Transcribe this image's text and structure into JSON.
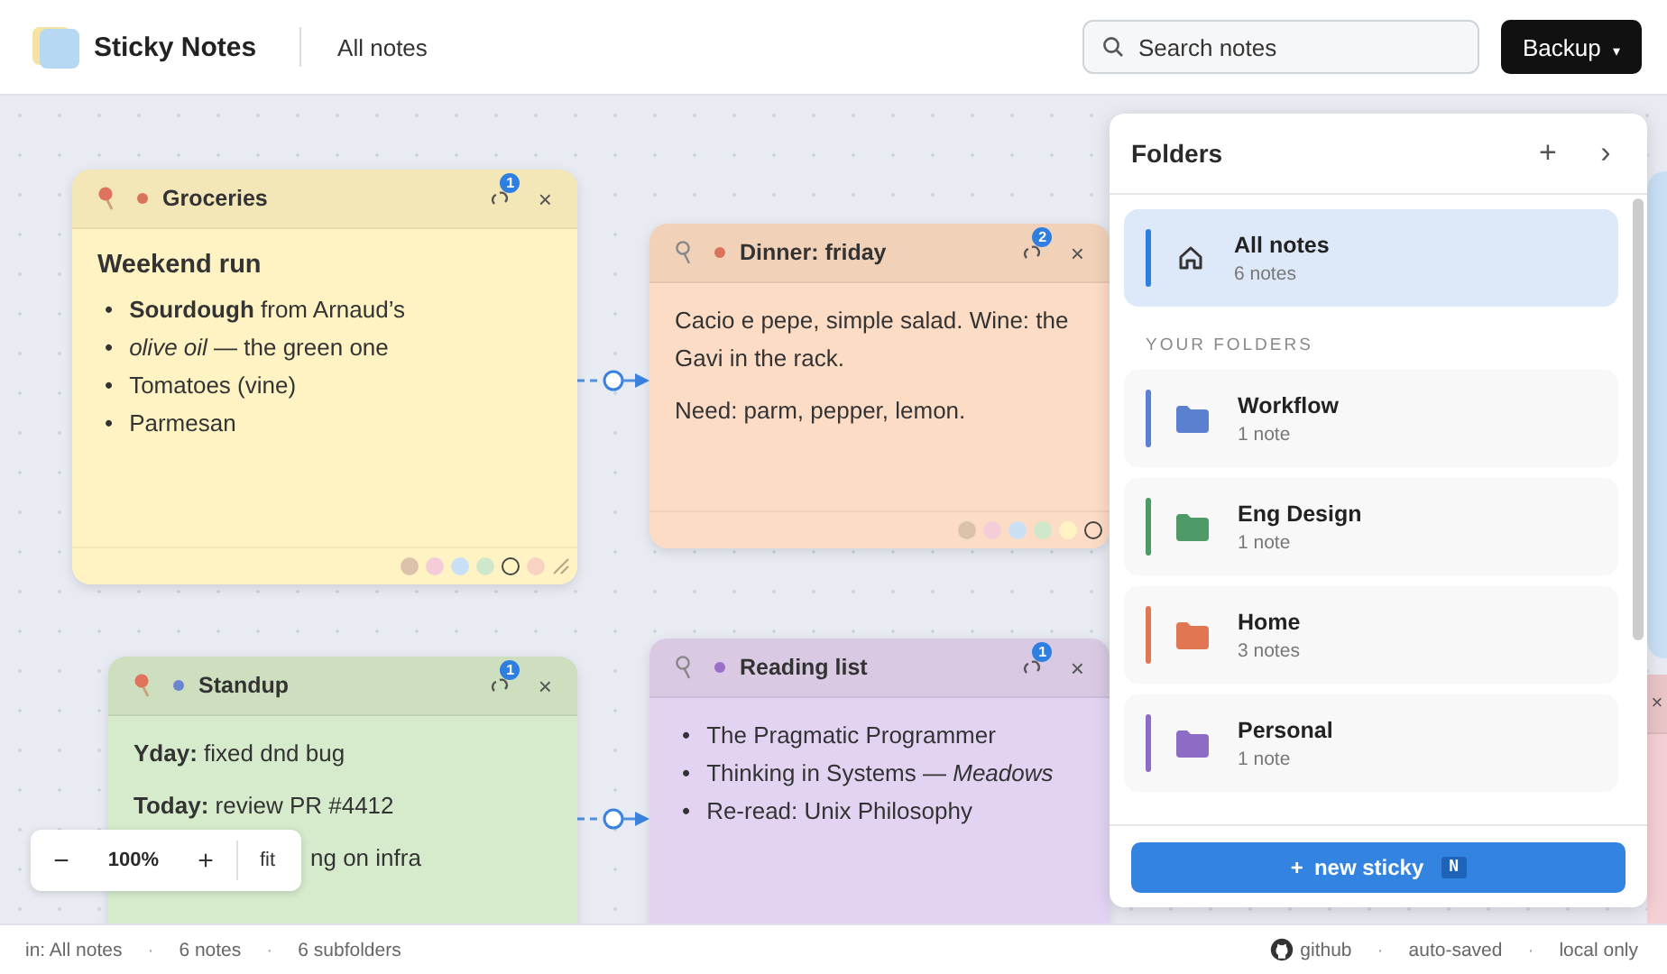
{
  "app": {
    "name": "Sticky Notes",
    "breadcrumb": "All notes"
  },
  "search": {
    "placeholder": "Search notes"
  },
  "backup_button": {
    "label": "Backup",
    "caret": "▾"
  },
  "notes": [
    {
      "title": "Groceries",
      "color": "#fff3c4",
      "pinned": true,
      "dot": {
        "color": "#d9735a"
      },
      "links": "1",
      "close": "×",
      "blocks": [
        {
          "kind": "heading",
          "text": "Weekend run"
        },
        {
          "kind": "list",
          "bullet": "•",
          "items": [
            "**Sourdough** from Arnaud’s",
            "*olive oil* — the green one",
            "Tomatoes (vine)",
            "Parmesan"
          ]
        }
      ],
      "swatches": [
        {
          "color": "#dcc2ab",
          "selected": false
        },
        {
          "color": "#f4cdd8",
          "selected": false
        },
        {
          "color": "#c9dff3",
          "selected": false
        },
        {
          "color": "#cfe8cb",
          "selected": false
        },
        {
          "color": "#fff3c4",
          "selected": true
        },
        {
          "color": "#f8d3c2",
          "selected": false
        }
      ]
    },
    {
      "title": "Dinner: friday",
      "color": "#fddcc6",
      "pinned": false,
      "dot": {
        "color": "#d9735a"
      },
      "links": "2",
      "close": "×",
      "blocks": [
        {
          "kind": "para",
          "text": "Cacio e pepe, simple salad. Wine: the Gavi in the rack."
        },
        {
          "kind": "para",
          "text": "Need: parm, pepper, lemon."
        }
      ],
      "swatches": [
        {
          "color": "#dcc2ab",
          "selected": false
        },
        {
          "color": "#f4cdd8",
          "selected": false
        },
        {
          "color": "#c9dff3",
          "selected": false
        },
        {
          "color": "#cfe8cb",
          "selected": false
        },
        {
          "color": "#fff3c4",
          "selected": false
        },
        {
          "color": "#fddcc6",
          "selected": true
        }
      ]
    },
    {
      "title": "Standup",
      "color": "#d5ebcb",
      "pinned": true,
      "dot": {
        "color": "#6b85d0"
      },
      "links": "1",
      "close": "×",
      "blocks": [
        {
          "kind": "para",
          "text": "**Yday:** fixed dnd bug"
        },
        {
          "kind": "para",
          "text": "**Today:** review PR #4412"
        },
        {
          "kind": "tail",
          "text": "ng on infra"
        }
      ]
    },
    {
      "title": "Reading list",
      "color": "#e2d3f3",
      "pinned": false,
      "dot": {
        "color": "#9b6fc7"
      },
      "links": "1",
      "close": "×",
      "blocks": [
        {
          "kind": "list",
          "bullet": "•",
          "items": [
            "The Pragmatic Programmer",
            "Thinking in Systems — *Meadows*",
            "Re-read: Unix Philosophy"
          ]
        }
      ]
    },
    {
      "color": "#f5cfd6",
      "close": "×"
    }
  ],
  "folders_panel": {
    "title": "Folders",
    "add": "+",
    "collapse": "›",
    "all": {
      "name": "All notes",
      "count": "6 notes",
      "selected": true
    },
    "section_label": "YOUR FOLDERS",
    "folders": [
      {
        "name": "Workflow",
        "count": "1 note",
        "color": "#5b80cf",
        "selected": false
      },
      {
        "name": "Eng Design",
        "count": "1 note",
        "color": "#4e9a66",
        "selected": false
      },
      {
        "name": "Home",
        "count": "3 notes",
        "color": "#e07752",
        "selected": false
      },
      {
        "name": "Personal",
        "count": "1 note",
        "color": "#8c6cc4",
        "selected": false
      }
    ],
    "new_button": {
      "icon": "+",
      "label": "new sticky",
      "shortcut": "N"
    }
  },
  "zoom": {
    "minus": "−",
    "level": "100%",
    "plus": "+",
    "fit": "fit"
  },
  "status_bar": {
    "left": [
      {
        "kind": "text",
        "text": "in: All notes"
      },
      {
        "kind": "sep",
        "text": "·"
      },
      {
        "kind": "text",
        "text": "6 notes"
      },
      {
        "kind": "sep",
        "text": "·"
      },
      {
        "kind": "text",
        "text": "6 subfolders"
      }
    ],
    "right": [
      {
        "kind": "link",
        "text": "github"
      },
      {
        "kind": "sep",
        "text": "·"
      },
      {
        "kind": "text",
        "text": "auto-saved"
      },
      {
        "kind": "sep",
        "text": "·"
      },
      {
        "kind": "text",
        "text": "local only"
      }
    ]
  }
}
